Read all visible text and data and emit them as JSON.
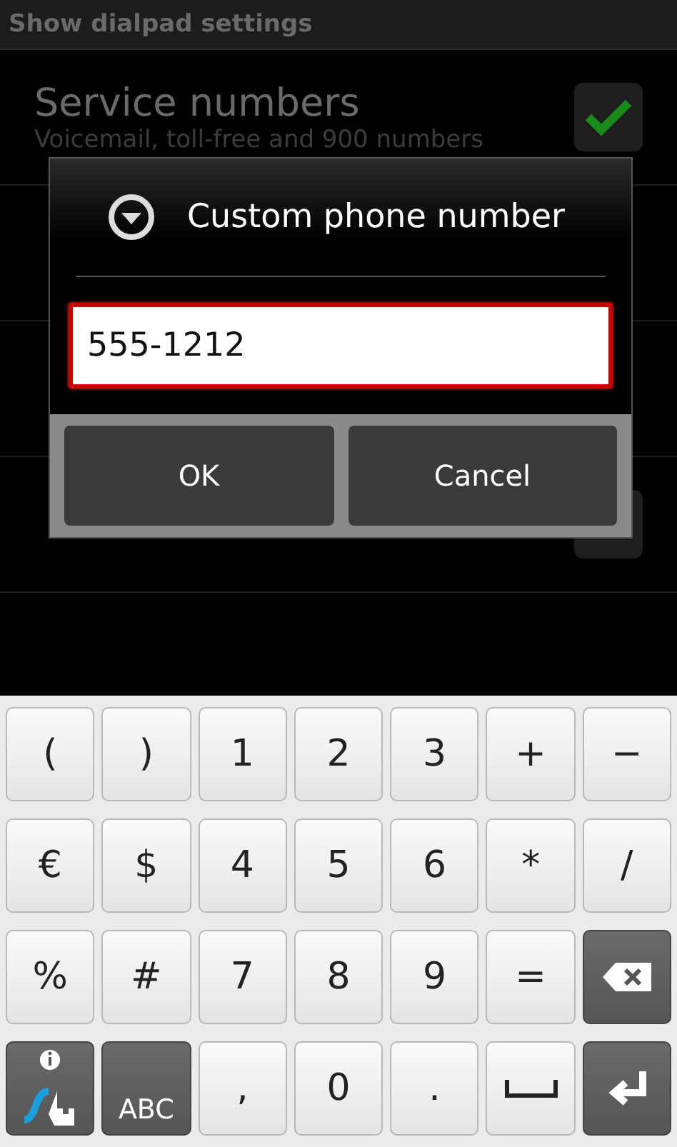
{
  "header": {
    "title": "Show dialpad settings"
  },
  "settings": [
    {
      "title": "Service numbers",
      "summary": "Voicemail, toll-free and 900 numbers",
      "kind": "checkbox",
      "checked": true
    },
    {
      "kind": "covered"
    },
    {
      "kind": "covered"
    },
    {
      "kind": "checkbox",
      "checked": false
    }
  ],
  "dialog": {
    "title": "Custom phone number",
    "value": "555-1212",
    "buttons": [
      "OK",
      "Cancel"
    ]
  },
  "keyboard": [
    [
      {
        "label": "(",
        "kind": "text"
      },
      {
        "label": ")",
        "kind": "text"
      },
      {
        "label": "1",
        "kind": "text"
      },
      {
        "label": "2",
        "kind": "text"
      },
      {
        "label": "3",
        "kind": "text"
      },
      {
        "label": "+",
        "kind": "text"
      },
      {
        "label": "−",
        "kind": "text"
      }
    ],
    [
      {
        "label": "€",
        "kind": "text"
      },
      {
        "label": "$",
        "kind": "text"
      },
      {
        "label": "4",
        "kind": "text"
      },
      {
        "label": "5",
        "kind": "text"
      },
      {
        "label": "6",
        "kind": "text"
      },
      {
        "label": "*",
        "kind": "text"
      },
      {
        "label": "/",
        "kind": "text"
      }
    ],
    [
      {
        "label": "%",
        "kind": "text"
      },
      {
        "label": "#",
        "kind": "text"
      },
      {
        "label": "7",
        "kind": "text"
      },
      {
        "label": "8",
        "kind": "text"
      },
      {
        "label": "9",
        "kind": "text"
      },
      {
        "label": "=",
        "kind": "text"
      },
      {
        "kind": "backspace"
      }
    ],
    [
      {
        "kind": "swype"
      },
      {
        "label": "ABC",
        "kind": "mode"
      },
      {
        "label": ",",
        "kind": "text"
      },
      {
        "label": "0",
        "kind": "text"
      },
      {
        "label": ".",
        "kind": "text"
      },
      {
        "kind": "space"
      },
      {
        "kind": "enter"
      }
    ]
  ]
}
